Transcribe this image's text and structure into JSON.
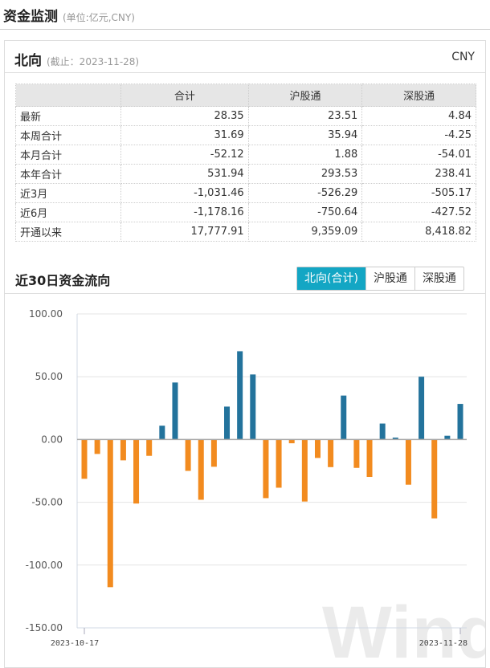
{
  "header": {
    "title": "资金监测",
    "unit": "(单位:亿元,CNY)"
  },
  "panel": {
    "title": "北向",
    "as_of": "(截止：2023-11-28)",
    "currency": "CNY"
  },
  "table": {
    "columns": [
      "",
      "合计",
      "沪股通",
      "深股通"
    ],
    "rows": [
      [
        "最新",
        "28.35",
        "23.51",
        "4.84"
      ],
      [
        "本周合计",
        "31.69",
        "35.94",
        "-4.25"
      ],
      [
        "本月合计",
        "-52.12",
        "1.88",
        "-54.01"
      ],
      [
        "本年合计",
        "531.94",
        "293.53",
        "238.41"
      ],
      [
        "近3月",
        "-1,031.46",
        "-526.29",
        "-505.17"
      ],
      [
        "近6月",
        "-1,178.16",
        "-750.64",
        "-427.52"
      ],
      [
        "开通以来",
        "17,777.91",
        "9,359.09",
        "8,418.82"
      ]
    ]
  },
  "chart_section": {
    "title": "近30日资金流向",
    "tabs": [
      {
        "label": "北向(合计)",
        "active": true
      },
      {
        "label": "沪股通",
        "active": false
      },
      {
        "label": "深股通",
        "active": false
      }
    ]
  },
  "chart_data": {
    "type": "bar",
    "title": "近30日资金流向",
    "xlabel": "",
    "ylabel": "",
    "ylim": [
      -150,
      100
    ],
    "yticks": [
      "100.00",
      "50.00",
      "0.00",
      "-50.00",
      "-100.00",
      "-150.00"
    ],
    "ytick_values": [
      100,
      50,
      0,
      -50,
      -100,
      -150
    ],
    "x_labels": [
      "2023-10-17",
      "2023-11-28"
    ],
    "values": [
      -31.3,
      -11.5,
      -117.6,
      -16.6,
      -51,
      -13,
      11,
      45.4,
      -25,
      -48,
      -21.7,
      26.2,
      70.3,
      51.8,
      -46.7,
      -38.4,
      -3,
      -49.4,
      -14.7,
      -22,
      35,
      -22.6,
      -29.8,
      12.7,
      1.5,
      -36,
      50,
      -62.8,
      3,
      28.35
    ],
    "positive_color": "#23739c",
    "negative_color": "#f28b1f",
    "grid": true,
    "watermark": "Wind"
  }
}
